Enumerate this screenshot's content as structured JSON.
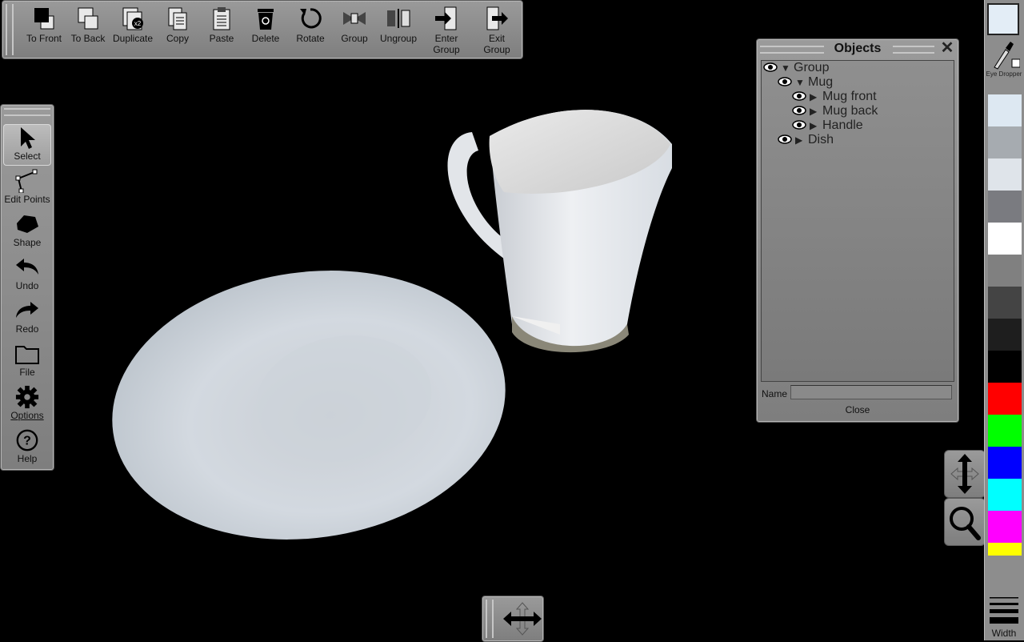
{
  "toolbar": {
    "to_front": "To Front",
    "to_back": "To Back",
    "duplicate": "Duplicate",
    "duplicate_badge": "x2",
    "copy": "Copy",
    "paste": "Paste",
    "delete": "Delete",
    "rotate": "Rotate",
    "group": "Group",
    "ungroup": "Ungroup",
    "enter_group_1": "Enter",
    "enter_group_2": "Group",
    "exit_group_1": "Exit",
    "exit_group_2": "Group"
  },
  "tools": {
    "select": "Select",
    "edit_points": "Edit Points",
    "shape": "Shape",
    "undo": "Undo",
    "redo": "Redo",
    "file": "File",
    "options": "Options",
    "help": "Help"
  },
  "objects_panel": {
    "title": "Objects",
    "tree": [
      {
        "label": "Group",
        "expanded": true
      },
      {
        "label": "Mug",
        "expanded": true
      },
      {
        "label": "Mug front",
        "expanded": false
      },
      {
        "label": "Mug back",
        "expanded": false
      },
      {
        "label": "Handle",
        "expanded": false
      },
      {
        "label": "Dish",
        "expanded": false
      }
    ],
    "name_label": "Name",
    "name_value": "",
    "close_label": "Close"
  },
  "palette": {
    "current_color": "#e3edf6",
    "eye_dropper_label": "Eye Dropper",
    "width_label": "Width",
    "swatches": [
      "#dde8f2",
      "#a6abb0",
      "#dfe4ea",
      "#7a7b80",
      "#ffffff",
      "#808080",
      "#444444",
      "#1e1e1e",
      "#000000",
      "#ff0000",
      "#00ff00",
      "#0000ff",
      "#00ffff",
      "#ff00ff",
      "#ffff00"
    ]
  },
  "icons": {
    "select": "arrow-cursor-icon",
    "edit_points": "edit-points-icon",
    "shape": "shape-icon",
    "undo": "undo-icon",
    "redo": "redo-icon",
    "file": "folder-icon",
    "options": "gear-icon",
    "help": "help-icon",
    "pan_vertical": "pan-vertical-icon",
    "zoom": "magnifier-icon",
    "pan_horizontal": "pan-horizontal-icon"
  }
}
